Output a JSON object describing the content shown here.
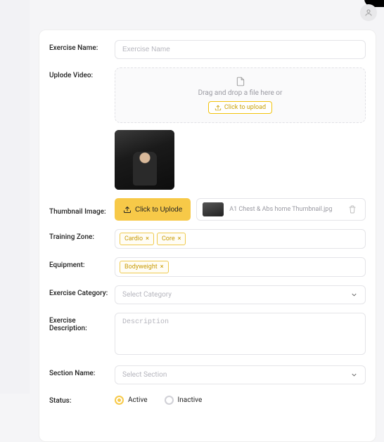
{
  "header": {
    "avatar_icon": "user-icon"
  },
  "form": {
    "exercise_name": {
      "label": "Exercise Name:",
      "placeholder": "Exercise Name",
      "value": ""
    },
    "upload_video": {
      "label": "Uplode Video:",
      "drop_text": "Drag and drop a file here or",
      "cta": "Click to upload"
    },
    "thumbnail": {
      "label": "Thumbnail Image:",
      "cta": "Click to Uplode",
      "filename": "A1 Chest & Abs home Thumbnail.jpg"
    },
    "training_zone": {
      "label": "Training Zone:",
      "tags": [
        "Cardio",
        "Core"
      ]
    },
    "equipment": {
      "label": "Equipment:",
      "tags": [
        "Bodyweight"
      ]
    },
    "category": {
      "label": "Exercise Category:",
      "placeholder": "Select Category"
    },
    "description": {
      "label": "Exercise Description:",
      "placeholder": "Description",
      "value": ""
    },
    "section": {
      "label": "Section Name:",
      "placeholder": "Select Section"
    },
    "status": {
      "label": "Status:",
      "options": [
        "Active",
        "Inactive"
      ],
      "selected": "Active"
    }
  }
}
